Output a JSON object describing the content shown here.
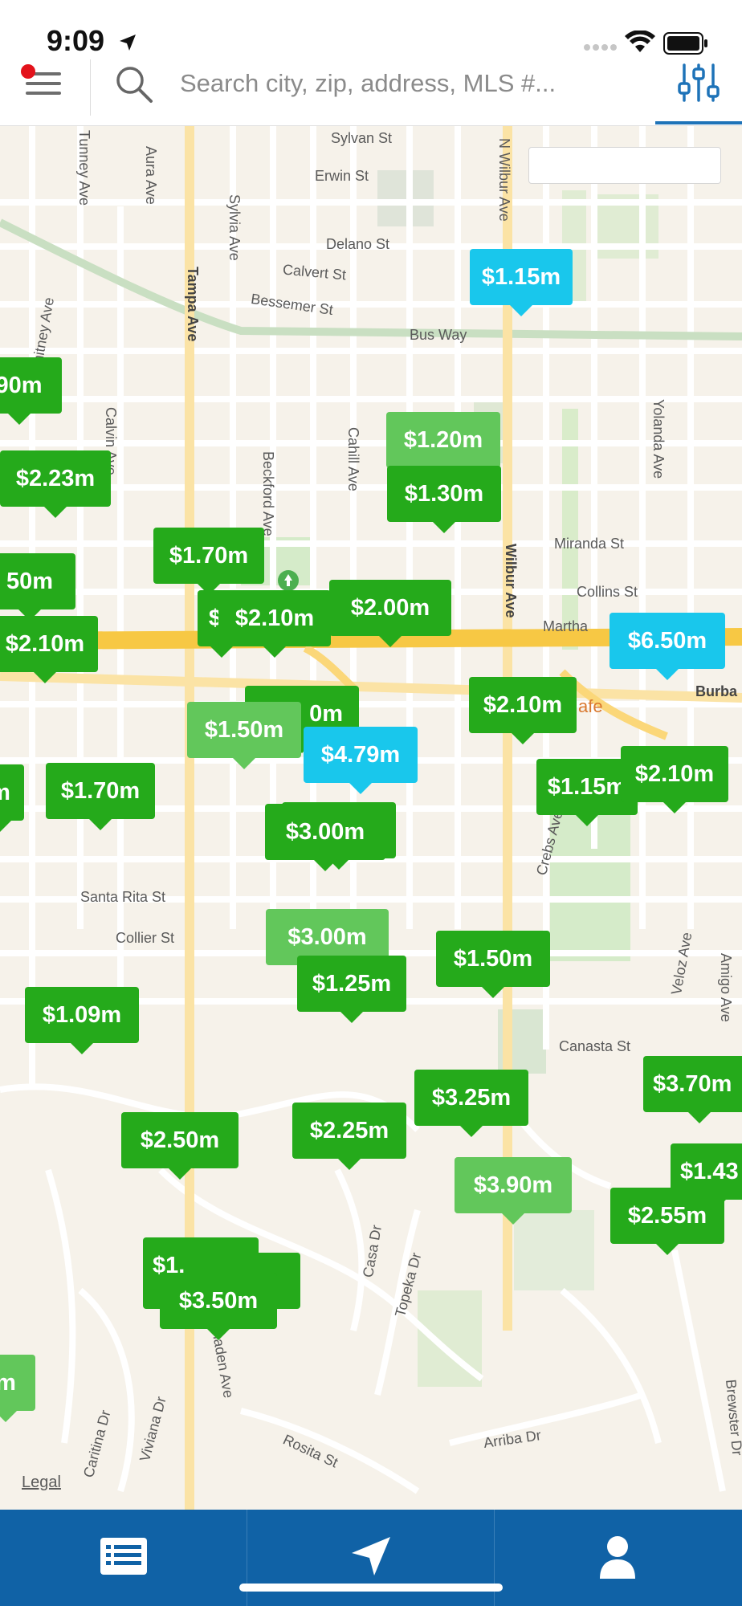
{
  "status_bar": {
    "time": "9:09"
  },
  "search": {
    "placeholder": "Search city, zip, address, MLS #..."
  },
  "map": {
    "legal_label": "Legal",
    "poi_label": "afe",
    "streets": [
      {
        "name": "Sylvan St"
      },
      {
        "name": "Erwin St"
      },
      {
        "name": "Delano St"
      },
      {
        "name": "Calvert St"
      },
      {
        "name": "Bessemer St"
      },
      {
        "name": "Bus Way"
      },
      {
        "name": "Miranda St"
      },
      {
        "name": "Collins St"
      },
      {
        "name": "Martha"
      },
      {
        "name": "Burba"
      },
      {
        "name": "Santa Rita St"
      },
      {
        "name": "Collier St"
      },
      {
        "name": "Canasta St"
      },
      {
        "name": "Arriba Dr"
      },
      {
        "name": "Rosita St"
      },
      {
        "name": "Tampa Ave"
      },
      {
        "name": "Wilbur Ave"
      },
      {
        "name": "N Wilbur Ave"
      },
      {
        "name": "Tunney Ave"
      },
      {
        "name": "Aura Ave"
      },
      {
        "name": "Sylvia Ave"
      },
      {
        "name": "Beckford Ave"
      },
      {
        "name": "Cahill Ave"
      },
      {
        "name": "Calvin Ave"
      },
      {
        "name": "Yolanda Ave"
      },
      {
        "name": "Crebs Ave"
      },
      {
        "name": "Veloz Ave"
      },
      {
        "name": "Amigo Ave"
      },
      {
        "name": "Casa Dr"
      },
      {
        "name": "Topeka Dr"
      },
      {
        "name": "Caritina Dr"
      },
      {
        "name": "Viviana Dr"
      },
      {
        "name": "Linnaden Ave"
      },
      {
        "name": "Brewster Dr"
      },
      {
        "name": "Whitney Ave"
      }
    ],
    "price_pins": [
      {
        "label": "$1.15m",
        "style": "blue"
      },
      {
        "label": "90m",
        "style": "green"
      },
      {
        "label": "$1.20m",
        "style": "light"
      },
      {
        "label": "$1.30m",
        "style": "green"
      },
      {
        "label": "$2.23m",
        "style": "green"
      },
      {
        "label": "50m",
        "style": "green"
      },
      {
        "label": "$1.70m",
        "style": "green"
      },
      {
        "label": "$2.10m",
        "style": "green"
      },
      {
        "label": "$2.00m",
        "style": "green"
      },
      {
        "label": "$2.10m",
        "style": "green"
      },
      {
        "label": "$6.50m",
        "style": "blue"
      },
      {
        "label": "$2.10m",
        "style": "green"
      },
      {
        "label": "0m",
        "style": "green"
      },
      {
        "label": "$1.50m",
        "style": "light"
      },
      {
        "label": "$4.79m",
        "style": "blue"
      },
      {
        "label": "$1.70m",
        "style": "green"
      },
      {
        "label": "$1.15m",
        "style": "green"
      },
      {
        "label": "$2.10m",
        "style": "green"
      },
      {
        "label": "$3.00m",
        "style": "green"
      },
      {
        "label": "$3.00m",
        "style": "light"
      },
      {
        "label": "$1.25m",
        "style": "green"
      },
      {
        "label": "$1.50m",
        "style": "green"
      },
      {
        "label": "$1.09m",
        "style": "green"
      },
      {
        "label": "$3.70m",
        "style": "green"
      },
      {
        "label": "$3.25m",
        "style": "green"
      },
      {
        "label": "$2.25m",
        "style": "green"
      },
      {
        "label": "$2.50m",
        "style": "green"
      },
      {
        "label": "$3.90m",
        "style": "light"
      },
      {
        "label": "$1.43",
        "style": "green"
      },
      {
        "label": "$2.55m",
        "style": "green"
      },
      {
        "label": "$1.",
        "style": "green"
      },
      {
        "label": "$3.50m",
        "style": "green"
      },
      {
        "label": "m",
        "style": "light"
      },
      {
        "label": "m",
        "style": "green"
      }
    ]
  },
  "bottom_nav": {
    "items": [
      {
        "icon": "list-icon"
      },
      {
        "icon": "location-arrow-icon"
      },
      {
        "icon": "user-icon"
      }
    ]
  },
  "colors": {
    "pin_green": "#25aa1b",
    "pin_light_green": "#62c75b",
    "pin_blue": "#19c7ec",
    "nav_blue": "#1062a6",
    "accent_blue": "#1e73b8",
    "highway_yellow": "#f7c844"
  }
}
